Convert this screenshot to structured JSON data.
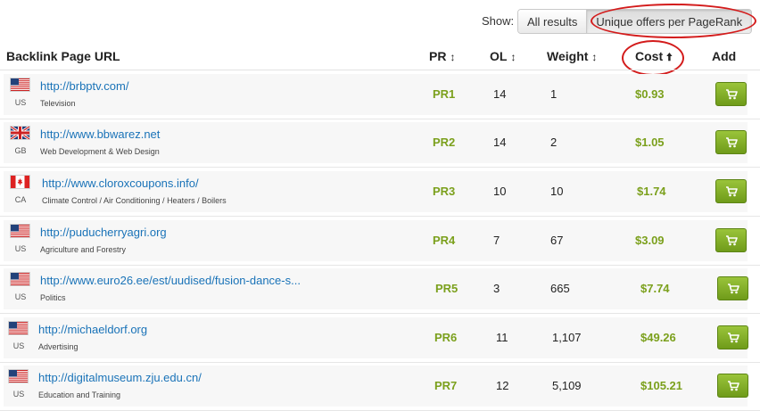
{
  "show": {
    "label": "Show:",
    "options": [
      "All results",
      "Unique offers per PageRank"
    ],
    "selected": "Unique offers per PageRank"
  },
  "table": {
    "headers": {
      "url": "Backlink Page URL",
      "pr": "PR",
      "ol": "OL",
      "weight": "Weight",
      "cost": "Cost",
      "add": "Add"
    },
    "sort": {
      "column": "Cost",
      "direction": "ascending"
    },
    "rows": [
      {
        "flag": "us-flag",
        "country": "US",
        "url": "http://brbptv.com/",
        "category": "Television",
        "pr": "PR1",
        "ol": "14",
        "weight": "1",
        "cost": "$0.93"
      },
      {
        "flag": "gb-flag",
        "country": "GB",
        "url": "http://www.bbwarez.net",
        "category": "Web Development & Web Design",
        "pr": "PR2",
        "ol": "14",
        "weight": "2",
        "cost": "$1.05"
      },
      {
        "flag": "ca-flag",
        "country": "CA",
        "url": "http://www.cloroxcoupons.info/",
        "category": "Climate Control / Air Conditioning / Heaters / Boilers",
        "pr": "PR3",
        "ol": "10",
        "weight": "10",
        "cost": "$1.74"
      },
      {
        "flag": "us-flag",
        "country": "US",
        "url": "http://puducherryagri.org",
        "category": "Agriculture and Forestry",
        "pr": "PR4",
        "ol": "7",
        "weight": "67",
        "cost": "$3.09"
      },
      {
        "flag": "us-flag",
        "country": "US",
        "url": "http://www.euro26.ee/est/uudised/fusion-dance-s...",
        "category": "Politics",
        "pr": "PR5",
        "ol": "3",
        "weight": "665",
        "cost": "$7.74"
      },
      {
        "flag": "us-flag",
        "country": "US",
        "url": "http://michaeldorf.org",
        "category": "Advertising",
        "pr": "PR6",
        "ol": "11",
        "weight": "1,107",
        "cost": "$49.26"
      },
      {
        "flag": "us-flag",
        "country": "US",
        "url": "http://digitalmuseum.zju.edu.cn/",
        "category": "Education and Training",
        "pr": "PR7",
        "ol": "12",
        "weight": "5,109",
        "cost": "$105.21"
      }
    ]
  },
  "colors": {
    "accent_green": "#7ba01c",
    "link_blue": "#1a73b8",
    "annotation_red": "#d31b1b"
  }
}
